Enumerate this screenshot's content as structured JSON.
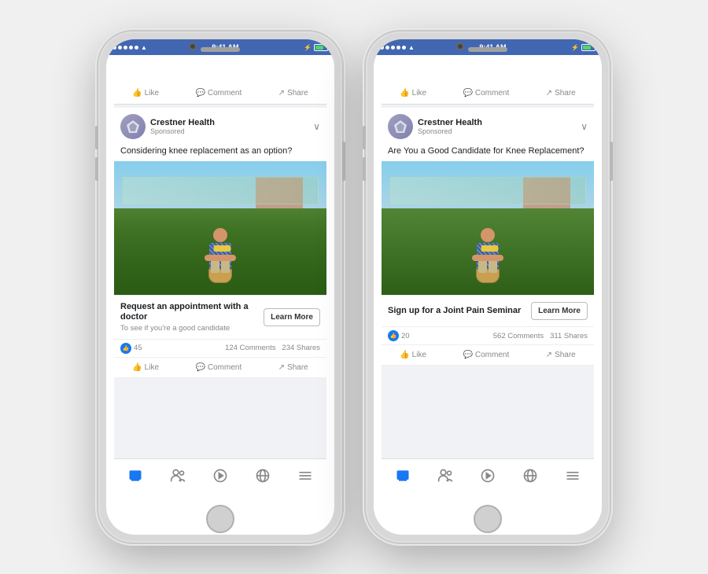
{
  "phones": [
    {
      "id": "phone1",
      "status_bar": {
        "time": "9:41 AM",
        "signal": "●●●●●",
        "wifi": "WiFi",
        "battery_level": "70%"
      },
      "post": {
        "page_name": "Crestner Health",
        "sponsored": "Sponsored",
        "post_text": "Considering knee replacement as an option?",
        "cta_title": "Request an appointment with a doctor",
        "cta_subtitle": "To see if you're a good candidate",
        "learn_more_label": "Learn More",
        "likes_count": "45",
        "comments": "124 Comments",
        "shares": "234 Shares"
      }
    },
    {
      "id": "phone2",
      "status_bar": {
        "time": "9:41 AM",
        "signal": "●●●●●",
        "wifi": "WiFi",
        "battery_level": "70%"
      },
      "post": {
        "page_name": "Crestner Health",
        "sponsored": "Sponsored",
        "post_text": "Are You a Good Candidate for Knee Replacement?",
        "cta_title": "Sign up for a Joint Pain Seminar",
        "cta_subtitle": "",
        "learn_more_label": "Learn More",
        "likes_count": "20",
        "comments": "562 Comments",
        "shares": "311 Shares"
      }
    }
  ],
  "action_bar": {
    "like": "Like",
    "comment": "Comment",
    "share": "Share"
  },
  "nav_icons": [
    "home",
    "friends",
    "play",
    "globe",
    "menu"
  ]
}
